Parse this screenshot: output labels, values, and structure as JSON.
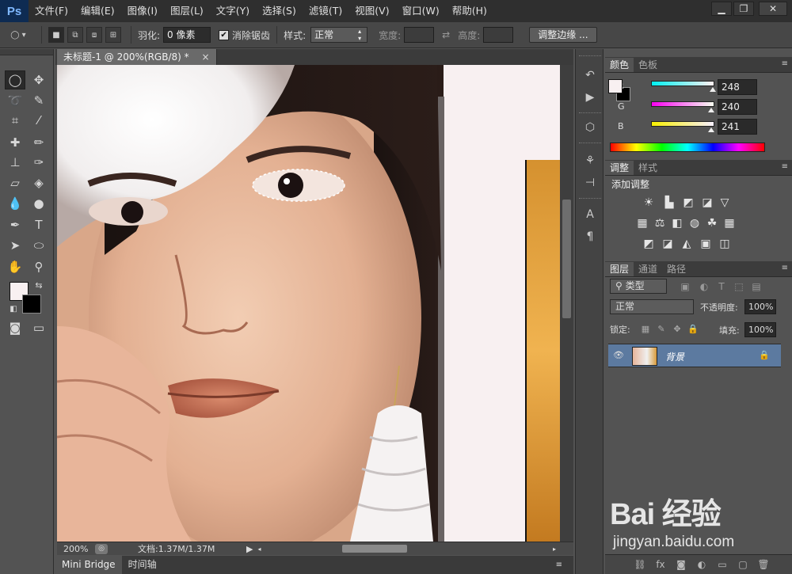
{
  "app": {
    "logo": "Ps"
  },
  "menu": [
    "文件(F)",
    "编辑(E)",
    "图像(I)",
    "图层(L)",
    "文字(Y)",
    "选择(S)",
    "滤镜(T)",
    "视图(V)",
    "窗口(W)",
    "帮助(H)"
  ],
  "window_controls": {
    "minimize": "▁",
    "restore": "❐",
    "close": "✕"
  },
  "options": {
    "feather_label": "羽化:",
    "feather_value": "0 像素",
    "antialias_label": "消除锯齿",
    "antialias_checked": "✔",
    "style_label": "样式:",
    "style_value": "正常",
    "width_label": "宽度:",
    "height_label": "高度:",
    "refine_button": "调整边缘 ..."
  },
  "document": {
    "tab_title": "未标题-1 @ 200%(RGB/8) *",
    "tab_close": "×",
    "zoom": "200%",
    "doc_size": "文档:1.37M/1.37M"
  },
  "bottom_tabs": [
    "Mini Bridge",
    "时间轴"
  ],
  "color_panel": {
    "tabs": [
      "颜色",
      "色板"
    ],
    "r_label": "R",
    "g_label": "G",
    "b_label": "B",
    "r": "248",
    "g": "240",
    "b": "241",
    "foreground": "#f8f0f1",
    "background": "#000000"
  },
  "adjust_panel": {
    "tabs": [
      "调整",
      "样式"
    ],
    "heading": "添加调整",
    "icons": [
      "brightness-icon",
      "levels-icon",
      "curves-icon",
      "exposure-icon",
      "vibrance-icon",
      "hue-saturation-icon",
      "color-balance-icon",
      "black-white-icon",
      "photo-filter-icon",
      "channel-mixer-icon",
      "color-lookup-icon",
      "invert-icon",
      "posterize-icon",
      "threshold-icon",
      "gradient-map-icon",
      "selective-color-icon"
    ]
  },
  "layers_panel": {
    "tabs": [
      "图层",
      "通道",
      "路径"
    ],
    "filter_kind": "类型",
    "blend_mode": "正常",
    "opacity_label": "不透明度:",
    "opacity": "100%",
    "lock_label": "锁定:",
    "fill_label": "填充:",
    "fill": "100%",
    "layers": [
      {
        "name": "背景",
        "visible": "👁",
        "locked": "🔒"
      }
    ]
  },
  "watermark": {
    "logo": "Bai 经验",
    "url": "jingyan.baidu.com"
  }
}
